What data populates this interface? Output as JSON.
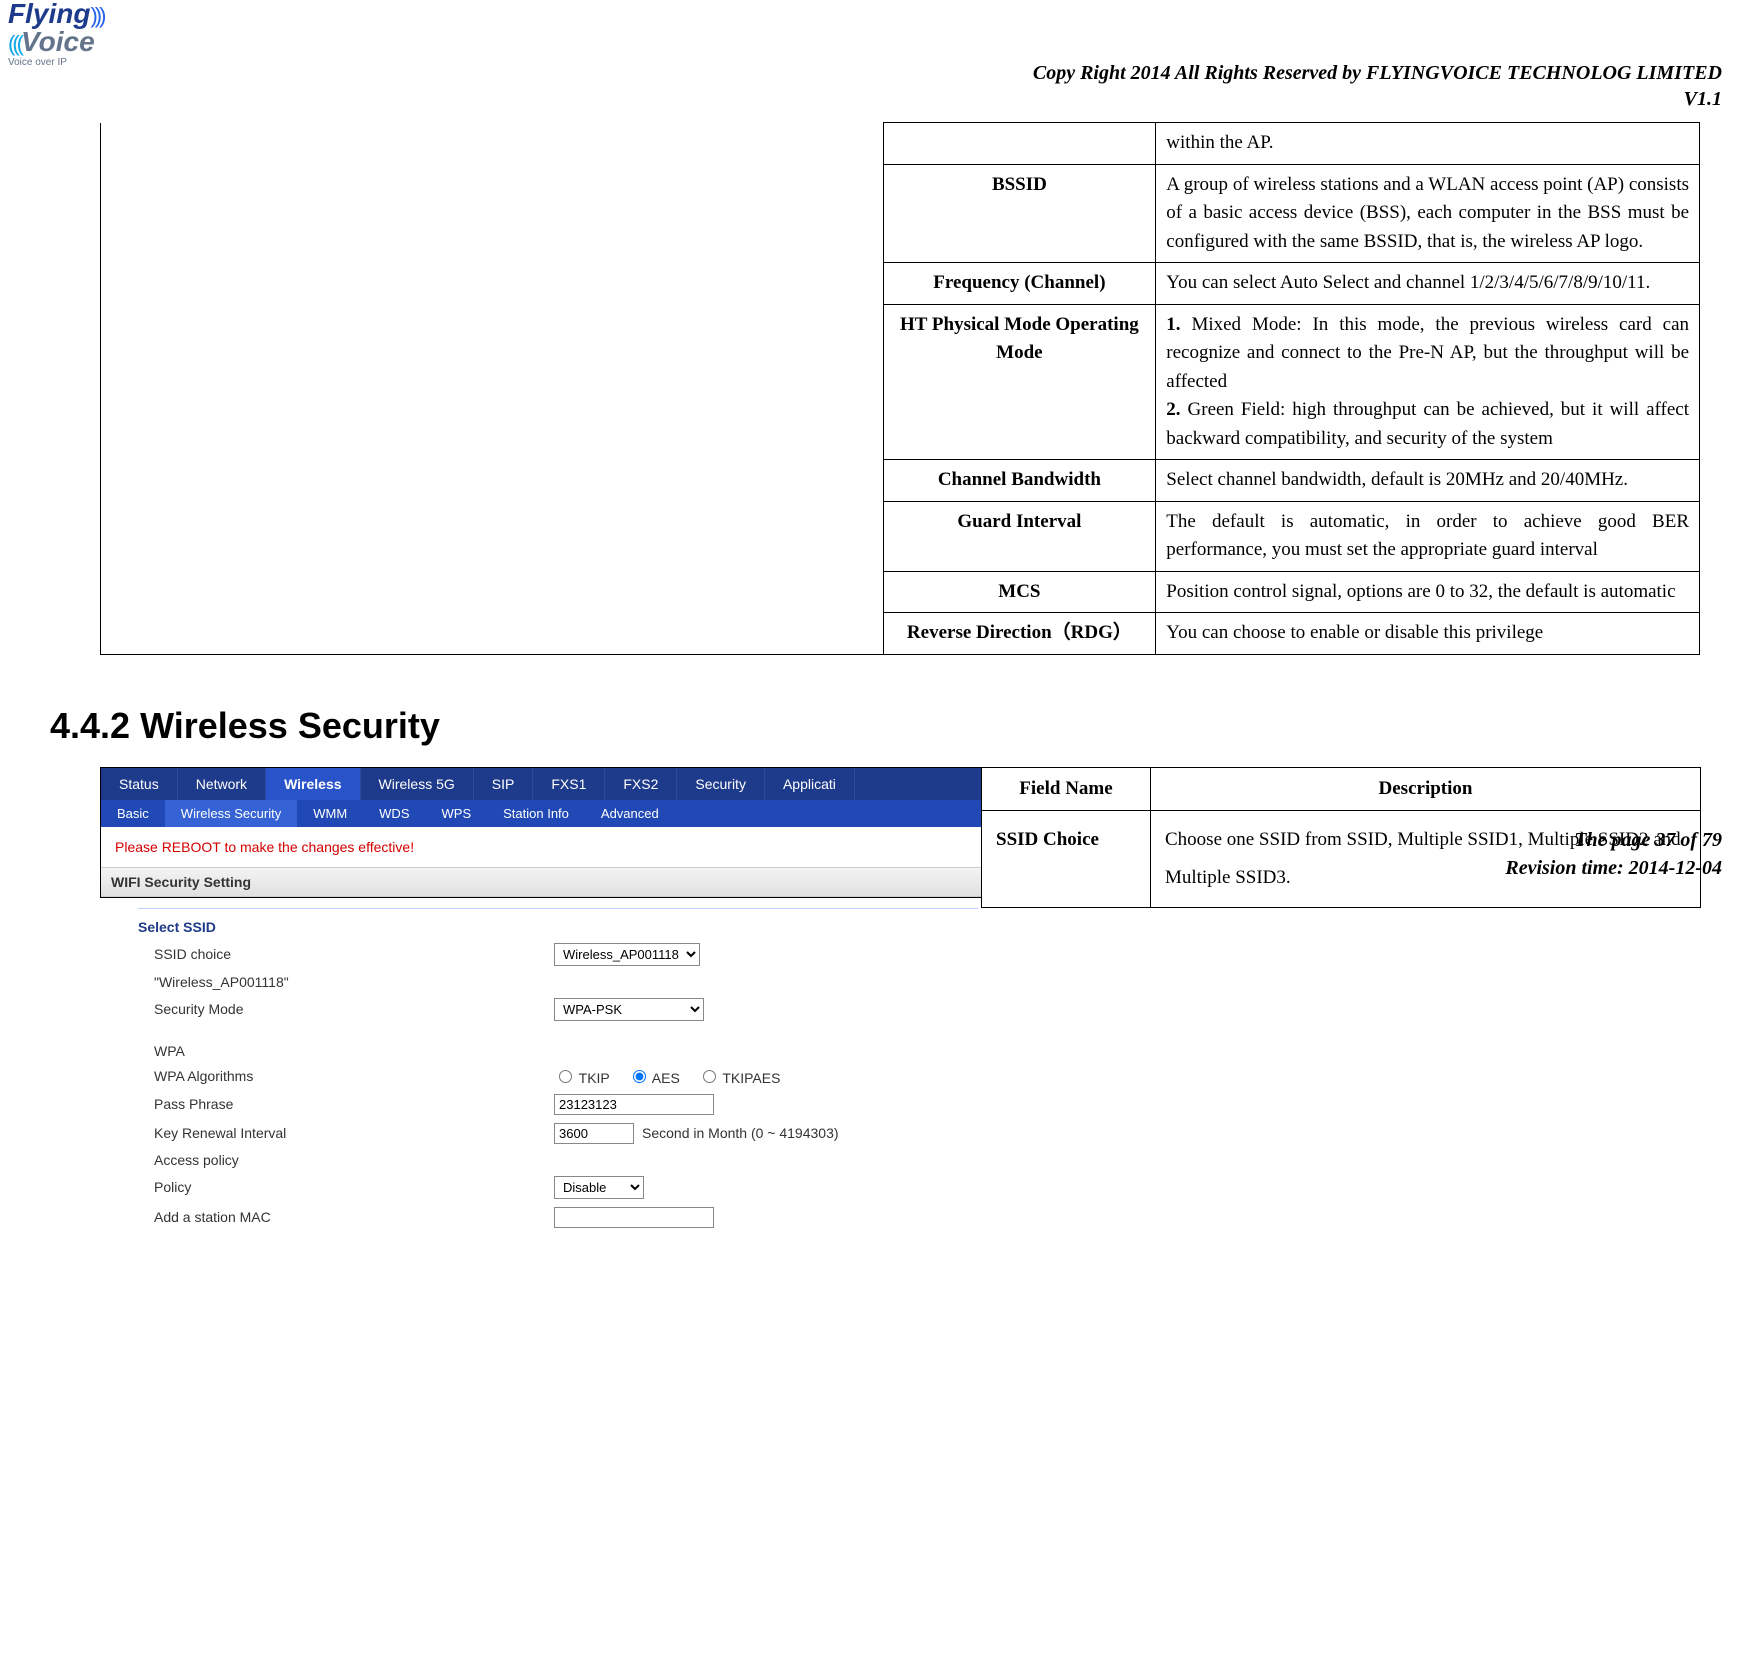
{
  "header": {
    "logo_flying": "Flying",
    "logo_voice": "Voice",
    "logo_tag": "Voice over IP",
    "copyright": "Copy Right 2014 All Rights Reserved by FLYINGVOICE TECHNOLOG LIMITED",
    "version": "V1.1"
  },
  "table1": {
    "rows": [
      {
        "label": "",
        "desc": "within the AP."
      },
      {
        "label": "BSSID",
        "desc": "A group of wireless stations and a WLAN access point (AP) consists of a basic access device (BSS), each computer in the BSS must be configured with the same BSSID, that is, the wireless AP logo."
      },
      {
        "label": "Frequency (Channel)",
        "desc": "You can select Auto Select and channel 1/2/3/4/5/6/7/8/9/10/11."
      },
      {
        "label": "HT Physical Mode Operating Mode",
        "desc": "1. Mixed Mode: In this mode, the previous wireless card can recognize and connect to the Pre-N AP, but the throughput will be affected\n2. Green Field: high throughput can be achieved, but it will affect backward compatibility, and security of the system"
      },
      {
        "label": "Channel Bandwidth",
        "desc": "Select channel bandwidth, default is 20MHz and 20/40MHz."
      },
      {
        "label": "Guard Interval",
        "desc": "The default is automatic, in order to achieve good BER performance, you must set the appropriate guard interval"
      },
      {
        "label": "MCS",
        "desc": "Position control signal, options are 0 to 32, the default is automatic"
      },
      {
        "label": "Reverse Direction（RDG）",
        "desc": "You can choose to enable or disable this privilege"
      }
    ]
  },
  "section_heading": "4.4.2 Wireless Security",
  "ui": {
    "tabs": [
      "Status",
      "Network",
      "Wireless",
      "Wireless 5G",
      "SIP",
      "FXS1",
      "FXS2",
      "Security",
      "Applicati"
    ],
    "active_tab": "Wireless",
    "subtabs": [
      "Basic",
      "Wireless Security",
      "WMM",
      "WDS",
      "WPS",
      "Station Info",
      "Advanced"
    ],
    "active_subtab": "Wireless Security",
    "reboot_msg": "Please REBOOT to make the changes effective!",
    "section_bar": "WIFI Security Setting",
    "group1": "Select SSID",
    "ssid_choice_lbl": "SSID choice",
    "ssid_choice_val": "Wireless_AP001118",
    "ssid_quoted": "\"Wireless_AP001118\"",
    "security_mode_lbl": "Security Mode",
    "security_mode_val": "WPA-PSK",
    "group2": "WPA",
    "wpa_alg_lbl": "WPA Algorithms",
    "wpa_alg_opts": [
      "TKIP",
      "AES",
      "TKIPAES"
    ],
    "wpa_alg_sel": "AES",
    "pass_lbl": "Pass Phrase",
    "pass_val": "23123123",
    "key_lbl": "Key Renewal Interval",
    "key_val": "3600",
    "key_after": "Second in Month   (0 ~ 4194303)",
    "policy_group": "Access policy",
    "policy_lbl": "Policy",
    "policy_val": "Disable",
    "addmac_lbl": "Add a station MAC"
  },
  "desc_table": {
    "head_field": "Field Name",
    "head_desc": "Description",
    "row_field": "SSID Choice",
    "row_desc": "Choose one SSID from SSID, Multiple SSID1, Multiple SSID2 and Multiple SSID3."
  },
  "footer": {
    "page": "The page 37 of 79",
    "rev": "Revision time: 2014-12-04"
  }
}
